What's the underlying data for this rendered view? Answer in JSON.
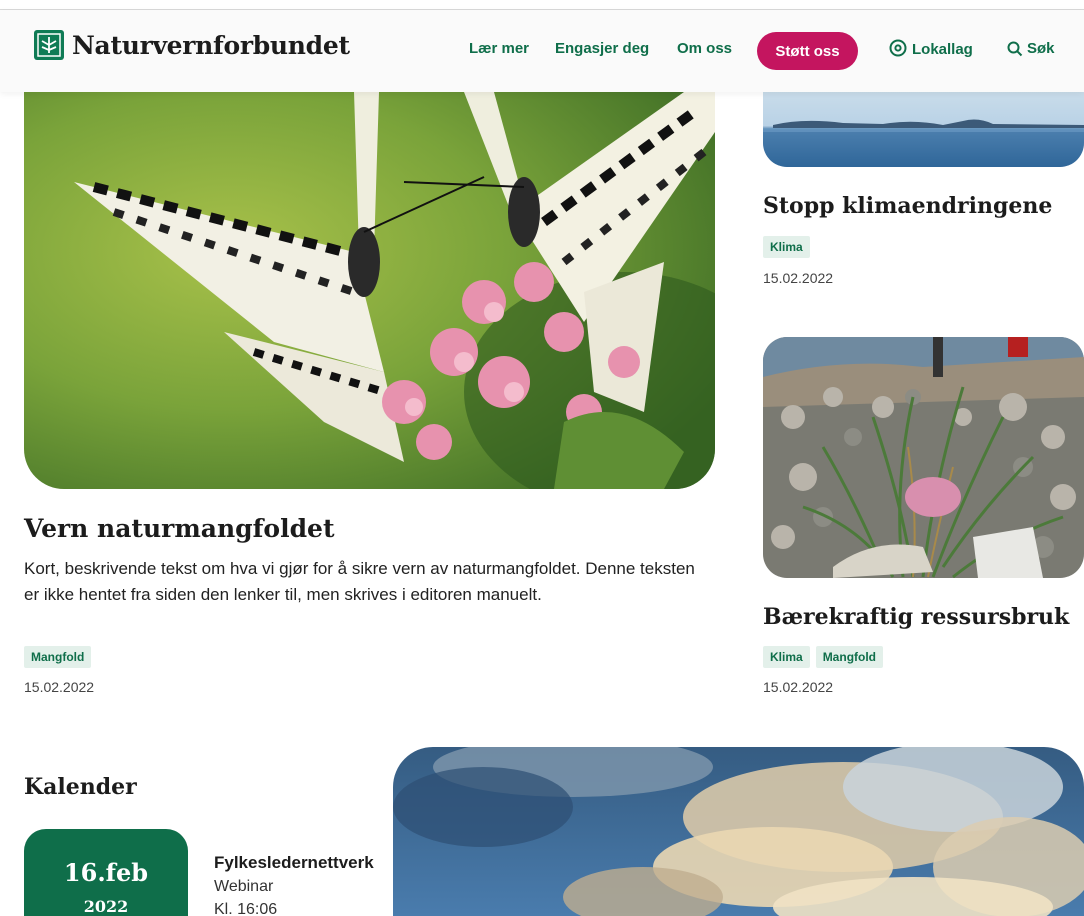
{
  "header": {
    "logo_text": "Naturvernforbundet",
    "nav": [
      {
        "label": "Lær mer"
      },
      {
        "label": "Engasjer deg"
      },
      {
        "label": "Om oss"
      }
    ],
    "support_label": "Støtt oss",
    "lokallag_label": "Lokallag",
    "search_label": "Søk"
  },
  "hero": {
    "title": "Vern naturmangfoldet",
    "description": "Kort, beskrivende tekst om hva vi gjør for å sikre vern av naturmangfoldet. Denne teksten er ikke hentet fra siden den lenker til, men skrives i editoren manuelt.",
    "tag": "Mangfold",
    "date": "15.02.2022"
  },
  "side_articles": [
    {
      "title": "Stopp klimaendringene",
      "tags": [
        "Klima"
      ],
      "date": "15.02.2022"
    },
    {
      "title": "Bærekraftig ressursbruk",
      "tags": [
        "Klima",
        "Mangfold"
      ],
      "date": "15.02.2022"
    }
  ],
  "calendar": {
    "title": "Kalender",
    "event": {
      "day": "16.feb",
      "year": "2022",
      "title": "Fylkesledernettverk",
      "type": "Webinar",
      "time": "Kl. 16:06"
    }
  },
  "colors": {
    "brand_green": "#0f6e4a",
    "accent_pink": "#c4155f",
    "tag_bg": "#e3f0ea"
  }
}
